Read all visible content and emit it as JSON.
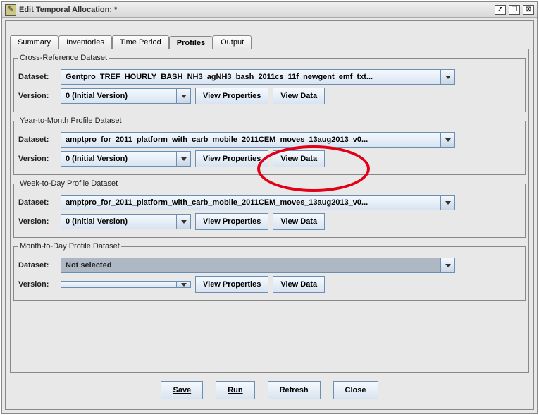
{
  "title": "Edit Temporal Allocation: *",
  "tabs": {
    "summary": "Summary",
    "inventories": "Inventories",
    "time_period": "Time Period",
    "profiles": "Profiles",
    "output": "Output"
  },
  "labels": {
    "dataset": "Dataset:",
    "version": "Version:",
    "view_properties": "View Properties",
    "view_data": "View Data",
    "not_selected": "Not selected"
  },
  "groups": {
    "xref": {
      "legend": "Cross-Reference Dataset",
      "dataset": "Gentpro_TREF_HOURLY_BASH_NH3_agNH3_bash_2011cs_11f_newgent_emf_txt...",
      "version": "0 (Initial Version)"
    },
    "ytm": {
      "legend": "Year-to-Month Profile Dataset",
      "dataset": "amptpro_for_2011_platform_with_carb_mobile_2011CEM_moves_13aug2013_v0...",
      "version": "0 (Initial Version)"
    },
    "wtd": {
      "legend": "Week-to-Day Profile Dataset",
      "dataset": "amptpro_for_2011_platform_with_carb_mobile_2011CEM_moves_13aug2013_v0...",
      "version": "0 (Initial Version)"
    },
    "mtd": {
      "legend": "Month-to-Day Profile Dataset",
      "dataset": "Not selected",
      "version": ""
    }
  },
  "bottom": {
    "save": "Save",
    "run": "Run",
    "refresh": "Refresh",
    "close": "Close"
  }
}
